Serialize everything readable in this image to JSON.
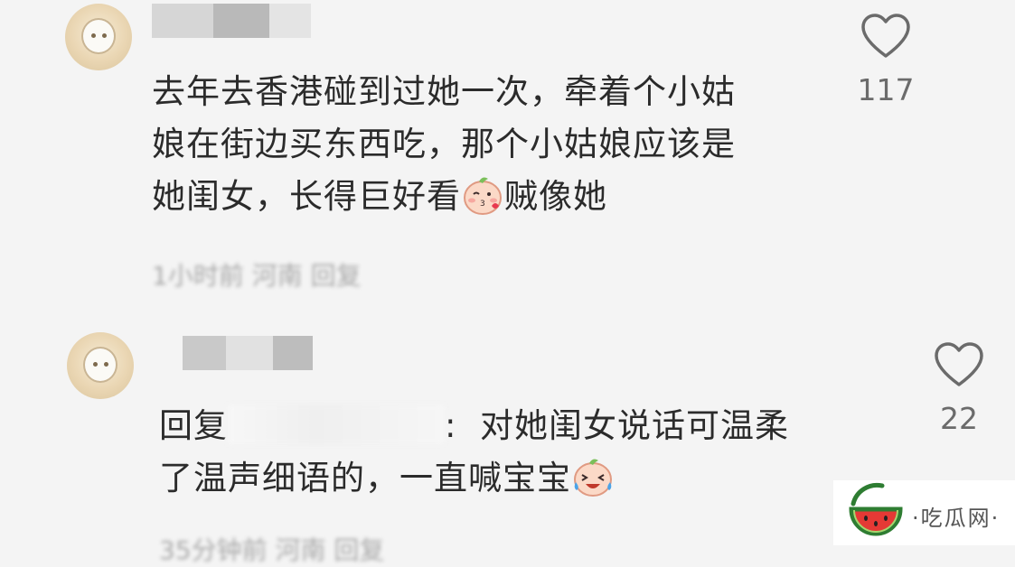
{
  "comments": [
    {
      "text_before_emoji": "去年去香港碰到过她一次，牵着个小姑\n娘在街边买东西吃，那个小姑娘应该是\n她闺女，长得巨好看",
      "text_after_emoji": "贼像她",
      "emoji_icon": "kiss-emoji",
      "meta": "1小时前  河南  回复",
      "like_count": "117"
    },
    {
      "reply_prefix": "回复",
      "text_after_mention": ":  对她闺女说话可温柔\n了温声细语的，一直喊宝宝",
      "emoji_icon": "laugh-cry-emoji",
      "meta": "35分钟前  河南  回复",
      "like_count": "22"
    }
  ],
  "watermark": {
    "label": "·吃瓜网·"
  }
}
